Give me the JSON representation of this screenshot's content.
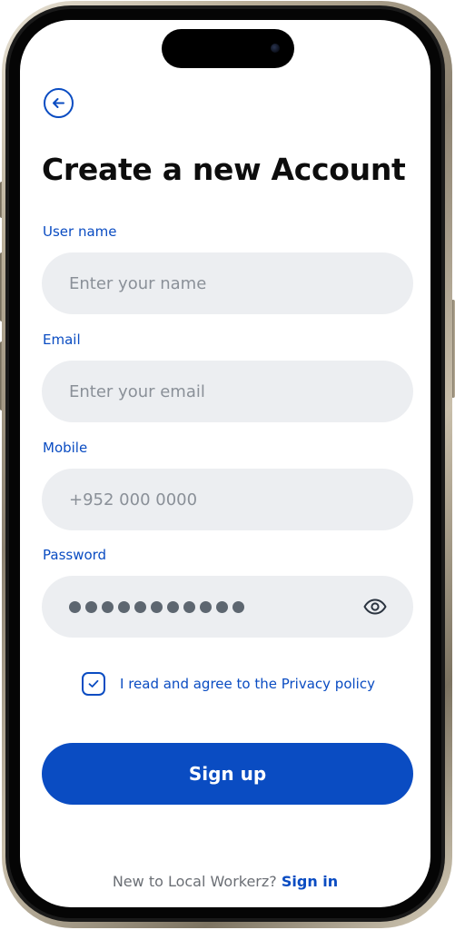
{
  "header": {
    "back_icon": "arrow-left-circle-icon",
    "title": "Create a new Account"
  },
  "form": {
    "username": {
      "label": "User name",
      "placeholder": "Enter your name",
      "value": ""
    },
    "email": {
      "label": "Email",
      "placeholder": "Enter your email",
      "value": ""
    },
    "mobile": {
      "label": "Mobile",
      "placeholder": "+952 000 0000",
      "value": ""
    },
    "password": {
      "label": "Password",
      "masked_length": 11,
      "toggle_icon": "eye-icon"
    },
    "agree": {
      "checked": true,
      "text": "I read and agree to the Privacy policy"
    },
    "submit_label": "Sign up"
  },
  "footer": {
    "question": "New to Local Workerz?",
    "link": "Sign in"
  },
  "colors": {
    "accent": "#0a4cc2",
    "field_bg": "#eceef1",
    "placeholder": "#8a9098",
    "title": "#0d0d0d"
  }
}
